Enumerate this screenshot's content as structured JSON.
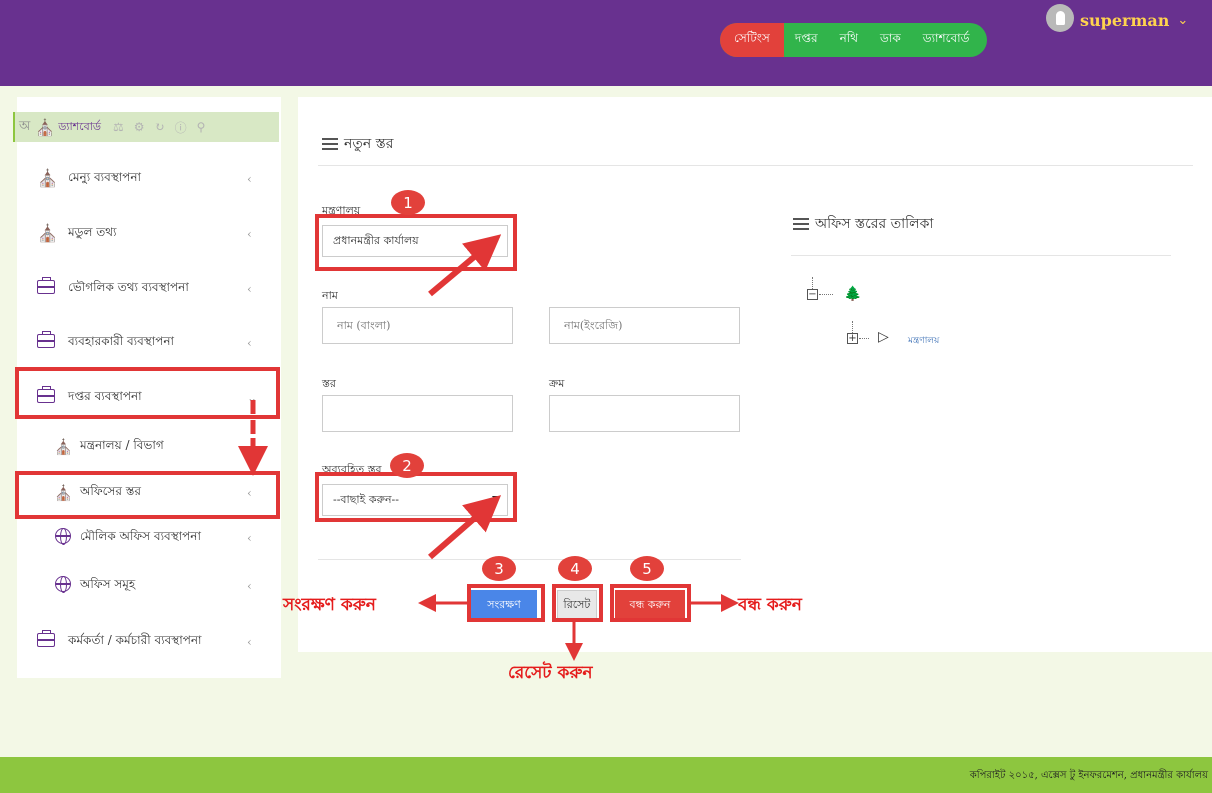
{
  "header": {
    "nav": [
      {
        "id": "settings",
        "label": "সেটিংস"
      },
      {
        "id": "dastar",
        "label": "দপ্তর"
      },
      {
        "id": "nothi",
        "label": "নথি"
      },
      {
        "id": "dak",
        "label": "ডাক"
      },
      {
        "id": "dashboard",
        "label": "ড্যাশবোর্ড"
      }
    ],
    "user_name": "superman",
    "user_caret": "⌄"
  },
  "sidebar": {
    "top_bar": {
      "letter": "অ",
      "label": "ড্যাশবোর্ড",
      "small_label": "বাড়ী"
    },
    "items": [
      {
        "label": "মেন্যু ব্যবস্থাপনা",
        "icon": "home-icon",
        "chevron": "‹"
      },
      {
        "label": "মডুল তথ্য",
        "icon": "home-icon",
        "chevron": "‹"
      },
      {
        "label": "ভৌগলিক তথ্য ব্যবস্থাপনা",
        "icon": "briefcase-icon",
        "chevron": "‹"
      },
      {
        "label": "ব্যবহারকারী ব্যবস্থাপনা",
        "icon": "briefcase-icon",
        "chevron": "‹"
      },
      {
        "label": "দপ্তর ব্যবস্থাপনা",
        "icon": "briefcase-icon",
        "chevron": "⌄"
      },
      {
        "label": "মন্ত্রনালয় / বিভাগ",
        "icon": "home-icon",
        "chevron": ""
      },
      {
        "label": "অফিসের স্তর",
        "icon": "home-icon",
        "chevron": "‹"
      },
      {
        "label": "মৌলিক অফিস ব্যবস্থাপনা",
        "icon": "globe-icon",
        "chevron": "‹"
      },
      {
        "label": "অফিস সমূহ",
        "icon": "globe-icon",
        "chevron": "‹"
      },
      {
        "label": "কর্মকর্তা / কর্মচারী ব্যবস্থাপনা",
        "icon": "briefcase-icon",
        "chevron": "‹"
      }
    ]
  },
  "form": {
    "title": "নতুন স্তর",
    "ministry_label": "মন্ত্রণালয়",
    "ministry_value": "প্রধানমন্ত্রীর কার্যালয়",
    "name_label": "নাম",
    "name_bn_placeholder": "নাম (বাংলা)",
    "name_en_placeholder": "নাম(ইংরেজি)",
    "layer_label": "স্তর",
    "order_label": "ক্রম",
    "parent_label": "অব্যবহিত স্তর",
    "parent_value": "--বাছাই করুন--",
    "buttons": {
      "save": "সংরক্ষণ",
      "reset": "রিসেট",
      "close": "বন্ধ করুন"
    }
  },
  "tree": {
    "title": "অফিস স্তরের তালিকা",
    "root_icon": "tree-icon",
    "child_label": "মন্ত্রণালয়"
  },
  "badges": [
    "1",
    "2",
    "3",
    "4",
    "5"
  ],
  "annotations": {
    "save": "সংরক্ষণ করুন",
    "reset": "রেসেট করুন",
    "close": "বন্ধ করুন"
  },
  "footer": {
    "copyright": "কপিরাইট ২০১৫, এক্সেস টু ইনফরমেশন, প্রধানমন্ত্রীর কার্যালয়"
  },
  "colors": {
    "header": "#68318f",
    "nav_active": "#e2413b",
    "nav_bg": "#31b44b",
    "footer": "#8dc63f",
    "annotation": "#e51c1c",
    "save_button": "#4a86e8"
  }
}
